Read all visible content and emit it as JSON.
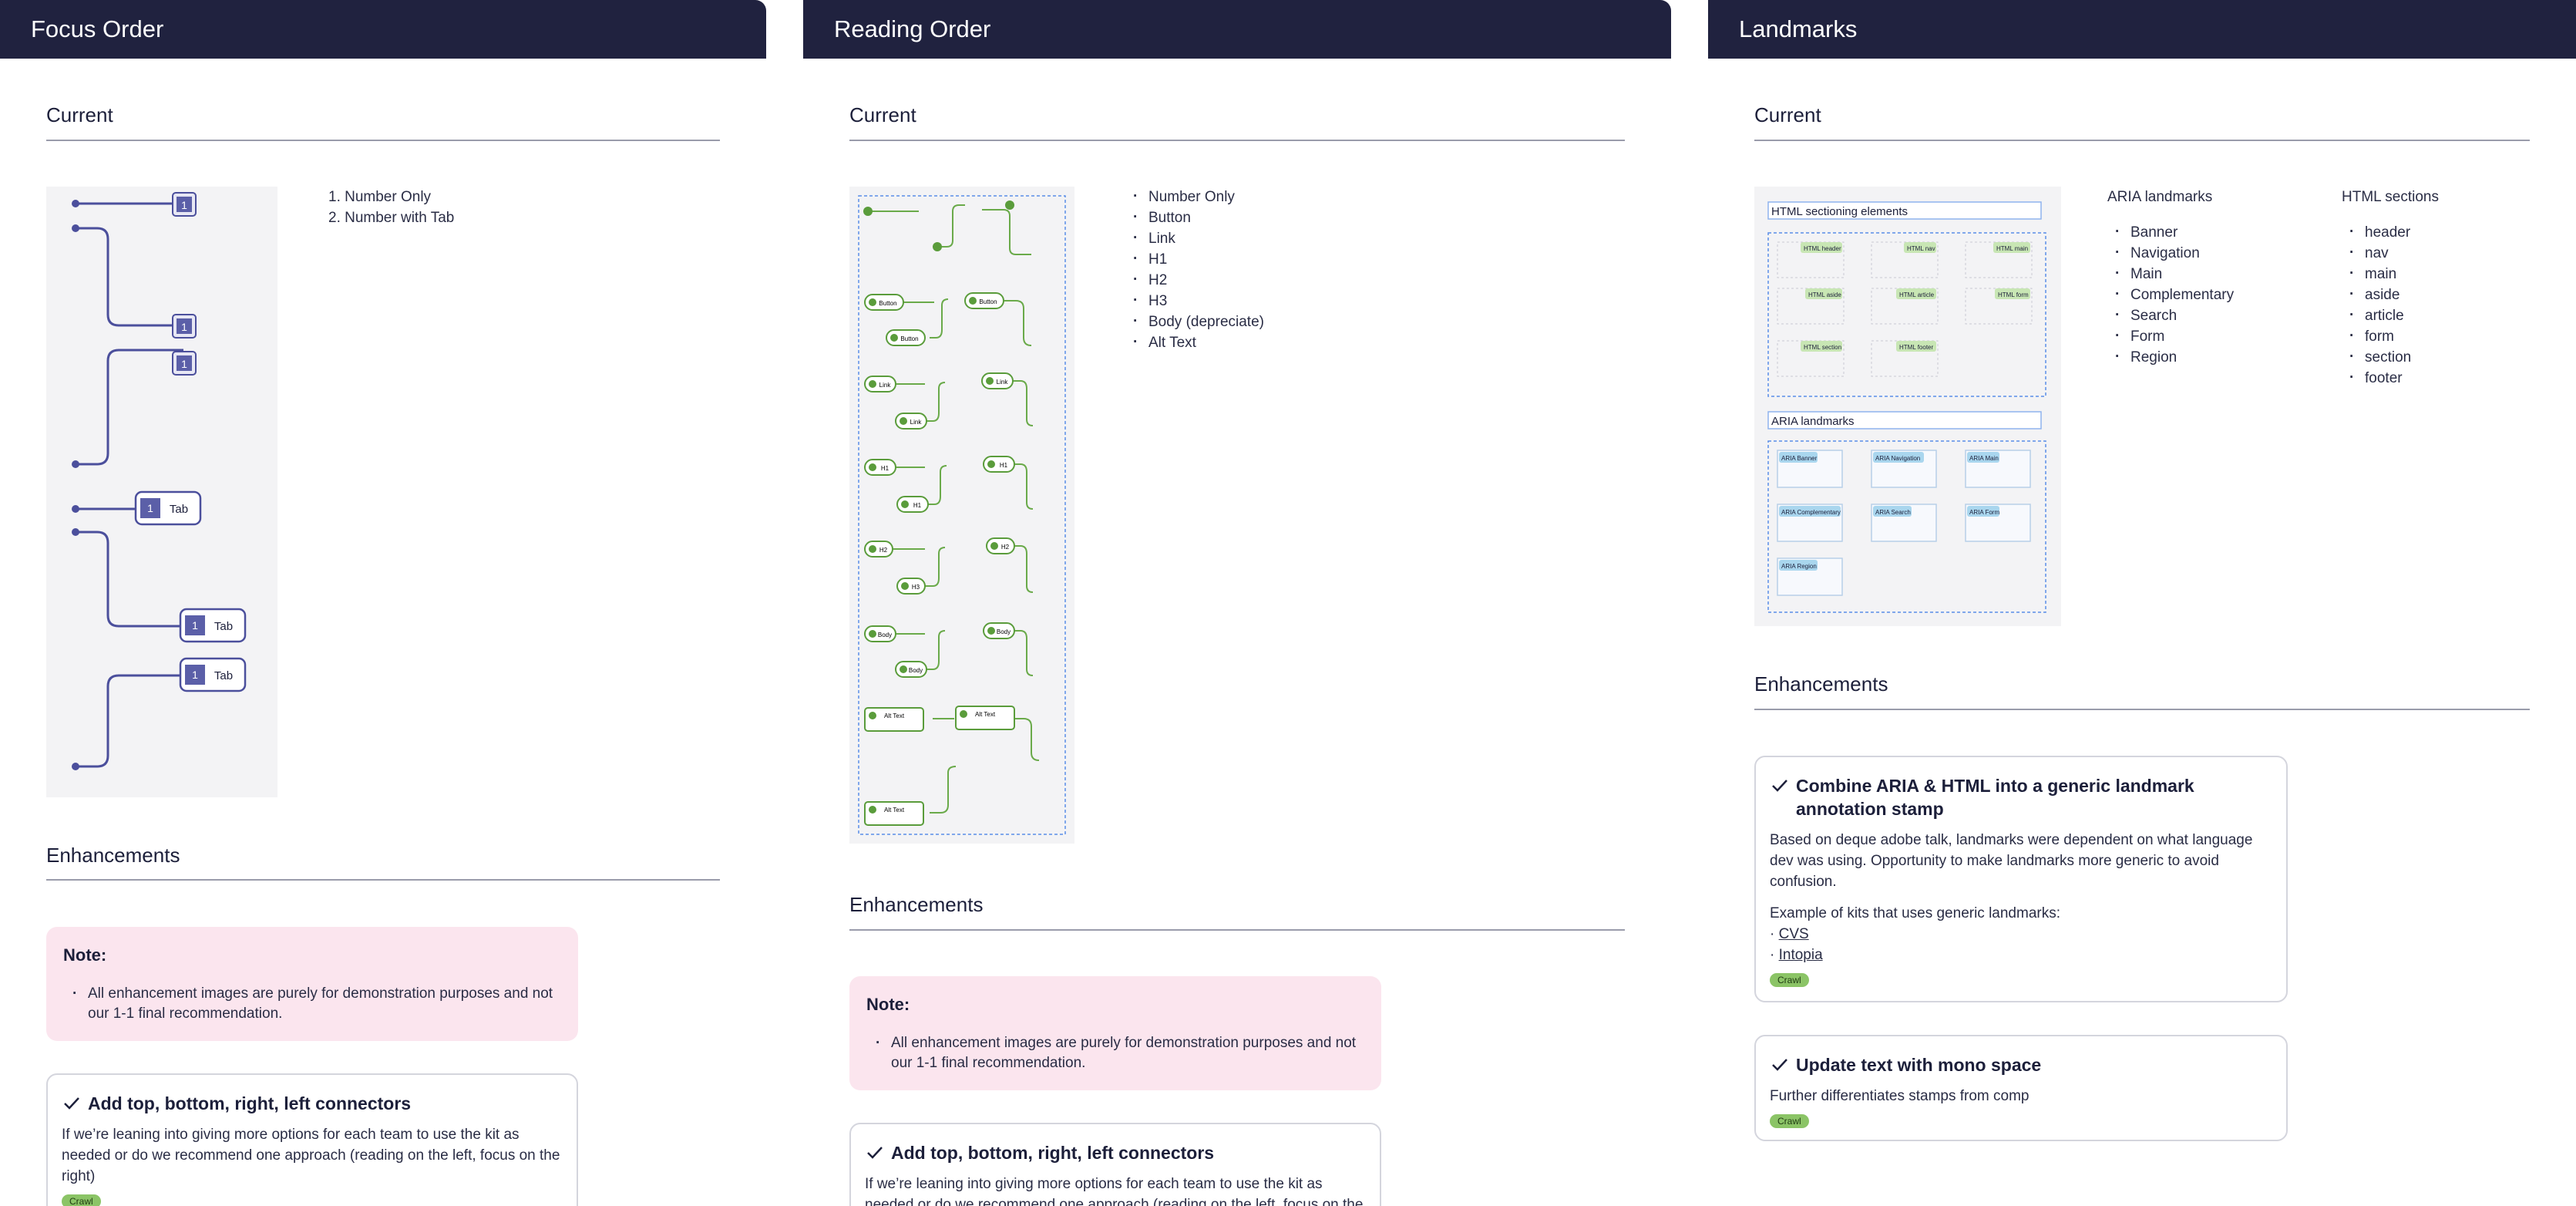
{
  "focus_order": {
    "header": "Focus Order",
    "current_title": "Current",
    "current_list": [
      "1. Number Only",
      "2. Number with Tab"
    ],
    "stamp_number": "1",
    "stamp_tab": "Tab",
    "enhancements_title": "Enhancements",
    "note": {
      "title": "Note:",
      "item": "All enhancement images are purely for demonstration purposes and not our 1-1 final recommendation."
    },
    "card": {
      "title": "Add top, bottom, right, left connectors",
      "body": "If we’re leaning into giving more options for each team to use the kit as needed or do we recommend one approach (reading on the left, focus on the right)",
      "badge": "Crawl"
    }
  },
  "reading_order": {
    "header": "Reading Order",
    "current_title": "Current",
    "current_list": [
      "Number Only",
      "Button",
      "Link",
      "H1",
      "H2",
      "H3",
      "Body (depreciate)",
      "Alt Text"
    ],
    "enhancements_title": "Enhancements",
    "note": {
      "title": "Note:",
      "item": "All enhancement images are purely for demonstration purposes and not our 1-1 final recommendation."
    },
    "card": {
      "title": "Add top, bottom, right, left connectors",
      "body": "If we’re leaning into giving more options for each team to use the kit as needed or do we recommend one approach (reading on the left, focus on the right)"
    },
    "stamp_labels": {
      "button": "Button",
      "link": "Link",
      "h1": "H1",
      "h2": "H2",
      "h3": "H3",
      "body": "Body",
      "alt": "Alt Text"
    }
  },
  "landmarks": {
    "header": "Landmarks",
    "current_title": "Current",
    "preview": {
      "html_title": "HTML sectioning elements",
      "html_tags": [
        "HTML header",
        "HTML nav",
        "HTML main",
        "HTML aside",
        "HTML article",
        "HTML form",
        "HTML section",
        "HTML footer"
      ],
      "aria_title": "ARIA landmarks",
      "aria_tags": [
        "ARIA Banner",
        "ARIA Navigation",
        "ARIA Main",
        "ARIA Complementary",
        "ARIA Search",
        "ARIA Form",
        "ARIA Region"
      ]
    },
    "aria_heading": "ARIA landmarks",
    "aria_list": [
      "Banner",
      "Navigation",
      "Main",
      "Complementary",
      "Search",
      "Form",
      "Region"
    ],
    "html_heading": "HTML sections",
    "html_list": [
      "header",
      "nav",
      "main",
      "aside",
      "article",
      "form",
      "section",
      "footer"
    ],
    "enhancements_title": "Enhancements",
    "card1": {
      "title": "Combine ARIA & HTML into a generic landmark annotation stamp",
      "body": "Based on deque adobe talk, landmarks were dependent on what language dev was using. Opportunity to make landmarks more generic to avoid confusion.",
      "examples_label": "Example of kits that uses generic landmarks:",
      "links": [
        "CVS",
        "Intopia"
      ],
      "badge": "Crawl"
    },
    "card2": {
      "title": "Update text with mono space",
      "body": "Further differentiates stamps from comp",
      "badge": "Crawl"
    }
  }
}
